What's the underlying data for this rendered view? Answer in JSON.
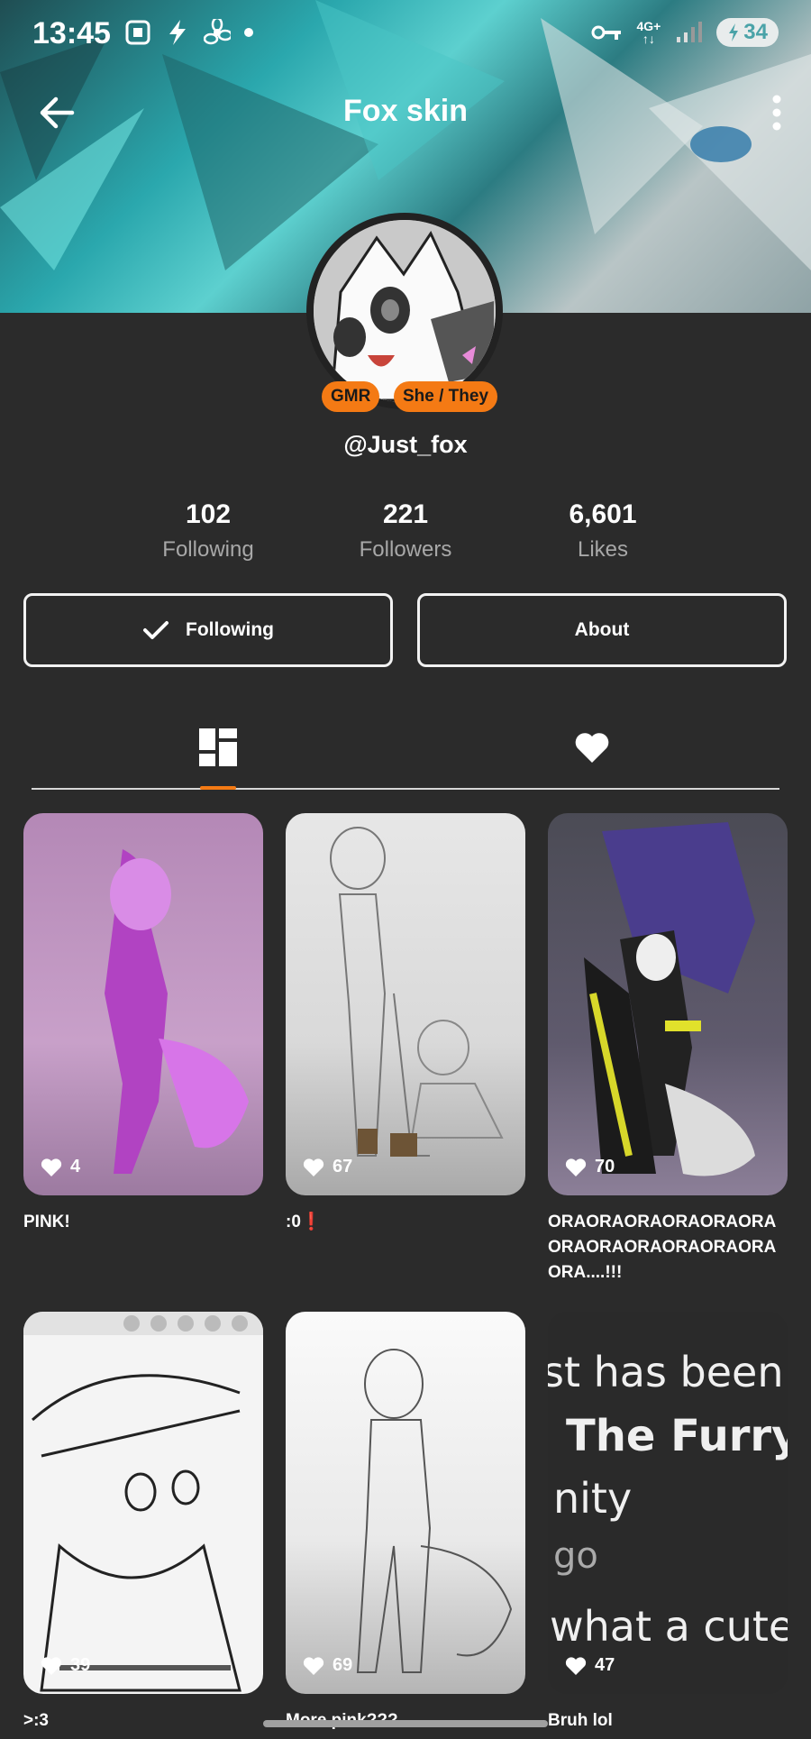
{
  "status_bar": {
    "time": "13:45",
    "network": "4G+",
    "battery": "34"
  },
  "header": {
    "title": "Fox skin"
  },
  "profile": {
    "badges": [
      "GMR",
      "She / They"
    ],
    "username": "@Just_fox",
    "stats": [
      {
        "value": "102",
        "label": "Following"
      },
      {
        "value": "221",
        "label": "Followers"
      },
      {
        "value": "6,601",
        "label": "Likes"
      }
    ],
    "following_button": "Following",
    "about_button": "About"
  },
  "tabs": {
    "active": "posts",
    "items": [
      "posts-grid-icon",
      "liked-heart-icon"
    ]
  },
  "posts": [
    {
      "likes": "4",
      "caption": "PINK!"
    },
    {
      "likes": "67",
      "caption": ":0❗"
    },
    {
      "likes": "70",
      "caption": "ORAORAORAORAORAORAORAORAORAORAORAORAORA....!!!"
    },
    {
      "likes": "39",
      "caption": ">:3"
    },
    {
      "likes": "69",
      "caption": "More pink???"
    },
    {
      "likes": "47",
      "caption": "Bruh lol"
    }
  ],
  "text_post_lines": [
    "st has been",
    "The Furry",
    "nity",
    "go",
    "what a cute"
  ],
  "colors": {
    "accent": "#f47a14",
    "background": "#2b2b2b",
    "banner_teal": "#2aa7ad"
  }
}
